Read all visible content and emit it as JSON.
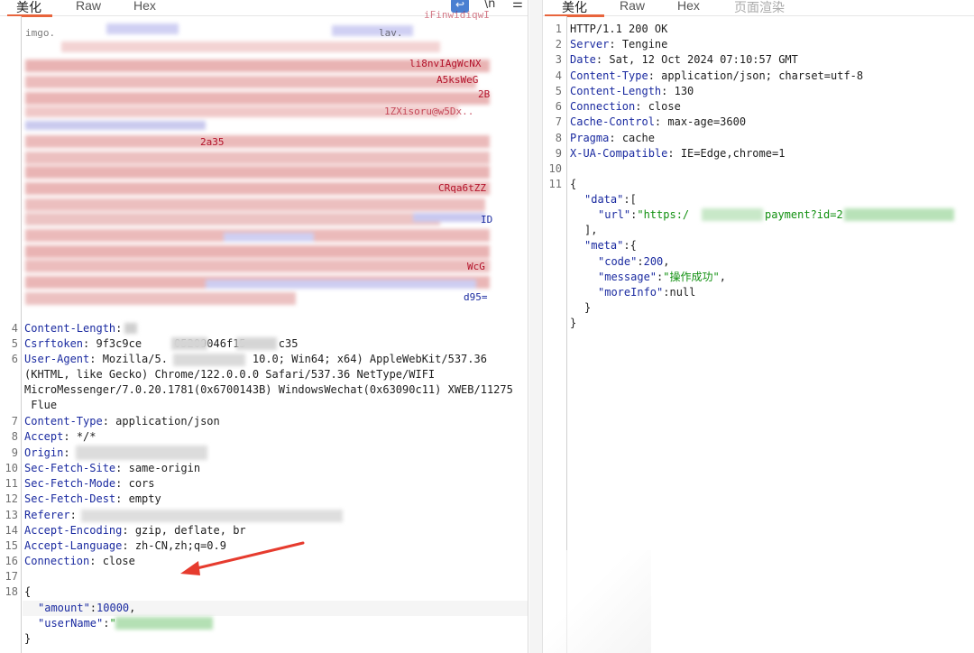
{
  "request_pane": {
    "tabs": [
      {
        "label": "美化",
        "active": true
      },
      {
        "label": "Raw",
        "active": false
      },
      {
        "label": "Hex",
        "active": false
      }
    ],
    "tools": {
      "wrap_icon": "wrap-lines-icon",
      "newline_label": "\\n",
      "menu_icon": "hamburger-menu-icon"
    },
    "header_lines": [
      {
        "num": "4",
        "key": "Content-Length",
        "value": ""
      },
      {
        "num": "5",
        "key": "Csrftoken",
        "value": "9f3c9ce     05209046f15     c35"
      },
      {
        "num": "6",
        "key": "User-Agent",
        "value": "Mozilla/5.             10.0; Win64; x64) AppleWebKit/537.36"
      },
      {
        "num": "",
        "key": "",
        "value": "(KHTML, like Gecko) Chrome/122.0.0.0 Safari/537.36 NetType/WIFI"
      },
      {
        "num": "",
        "key": "",
        "value": "MicroMessenger/7.0.20.1781(0x6700143B) WindowsWechat(0x63090c11) XWEB/11275"
      },
      {
        "num": "",
        "key": "",
        "value": " Flue"
      },
      {
        "num": "7",
        "key": "Content-Type",
        "value": "application/json"
      },
      {
        "num": "8",
        "key": "Accept",
        "value": "*/*"
      },
      {
        "num": "9",
        "key": "Origin",
        "value": ""
      },
      {
        "num": "10",
        "key": "Sec-Fetch-Site",
        "value": "same-origin"
      },
      {
        "num": "11",
        "key": "Sec-Fetch-Mode",
        "value": "cors"
      },
      {
        "num": "12",
        "key": "Sec-Fetch-Dest",
        "value": "empty"
      },
      {
        "num": "13",
        "key": "Referer",
        "value": ""
      },
      {
        "num": "14",
        "key": "Accept-Encoding",
        "value": "gzip, deflate, br"
      },
      {
        "num": "15",
        "key": "Accept-Language",
        "value": "zh-CN,zh;q=0.9"
      },
      {
        "num": "16",
        "key": "Connection",
        "value": "close"
      },
      {
        "num": "17",
        "key": "",
        "value": ""
      }
    ],
    "body_lines": {
      "n18": "18",
      "open_brace": "{",
      "amount_key": "\"amount\"",
      "amount_value": "10000",
      "username_key": "\"userName\"",
      "username_value": "\"",
      "close_brace": "}"
    },
    "top_fragments": {
      "frag_1": "iFinwidiqwI",
      "frag_2": "imgo.",
      "frag_3": "lav.",
      "frag_4": "li8nvIAgWcNX",
      "frag_5": "A5ksWeG",
      "frag_6": "2B",
      "frag_7": "1ZXisoru@w5Dx..",
      "frag_8": "2a35",
      "frag_9": "CRqa6tZZ",
      "frag_10": "ID",
      "frag_11": "WcG",
      "frag_12": "d95="
    }
  },
  "response_pane": {
    "tabs": [
      {
        "label": "美化",
        "active": true
      },
      {
        "label": "Raw",
        "active": false
      },
      {
        "label": "Hex",
        "active": false
      },
      {
        "label": "页面渲染",
        "active": false
      }
    ],
    "lines": [
      {
        "num": "1",
        "key": "",
        "value": "HTTP/1.1 200 OK"
      },
      {
        "num": "2",
        "key": "Server",
        "value": "Tengine"
      },
      {
        "num": "3",
        "key": "Date",
        "value": "Sat, 12 Oct 2024 07:10:57 GMT"
      },
      {
        "num": "4",
        "key": "Content-Type",
        "value": "application/json; charset=utf-8"
      },
      {
        "num": "5",
        "key": "Content-Length",
        "value": "130"
      },
      {
        "num": "6",
        "key": "Connection",
        "value": "close"
      },
      {
        "num": "7",
        "key": "Cache-Control",
        "value": "max-age=3600"
      },
      {
        "num": "8",
        "key": "Pragma",
        "value": "cache"
      },
      {
        "num": "9",
        "key": "X-UA-Compatible",
        "value": "IE=Edge,chrome=1"
      },
      {
        "num": "10",
        "key": "",
        "value": ""
      },
      {
        "num": "11",
        "key": "",
        "value": "{"
      }
    ],
    "json": {
      "data_key": "\"data\"",
      "url_key": "\"url\"",
      "url_prefix": "\"https:/",
      "url_suffix": "payment?id=2",
      "meta_key": "\"meta\"",
      "code_key": "\"code\"",
      "code_value": "200",
      "message_key": "\"message\"",
      "message_value": "\"操作成功\"",
      "moreinfo_key": "\"moreInfo\"",
      "moreinfo_value": "null"
    }
  },
  "colors": {
    "accent_tab": "#e8643c",
    "header_key": "#1a2aa0",
    "json_string": "#119010",
    "annotation_arrow": "#e63b2e"
  }
}
